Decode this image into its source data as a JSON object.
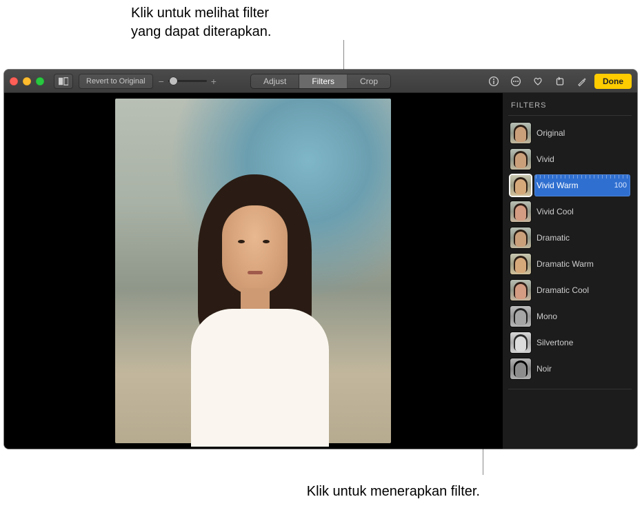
{
  "callouts": {
    "top": "Klik untuk melihat filter\nyang dapat diterapkan.",
    "bottom": "Klik untuk menerapkan filter."
  },
  "toolbar": {
    "revert_label": "Revert to Original",
    "zoom_minus": "−",
    "zoom_plus": "+",
    "tabs": {
      "adjust": "Adjust",
      "filters": "Filters",
      "crop": "Crop"
    },
    "done_label": "Done"
  },
  "sidebar": {
    "title": "FILTERS",
    "selected_intensity": "100",
    "items": [
      {
        "label": "Original",
        "thumb_class": ""
      },
      {
        "label": "Vivid",
        "thumb_class": ""
      },
      {
        "label": "Vivid Warm",
        "thumb_class": "warm",
        "selected": true
      },
      {
        "label": "Vivid Cool",
        "thumb_class": "cool"
      },
      {
        "label": "Dramatic",
        "thumb_class": ""
      },
      {
        "label": "Dramatic Warm",
        "thumb_class": "warm"
      },
      {
        "label": "Dramatic Cool",
        "thumb_class": "cool"
      },
      {
        "label": "Mono",
        "thumb_class": "mono"
      },
      {
        "label": "Silvertone",
        "thumb_class": "silver"
      },
      {
        "label": "Noir",
        "thumb_class": "noir"
      }
    ]
  }
}
